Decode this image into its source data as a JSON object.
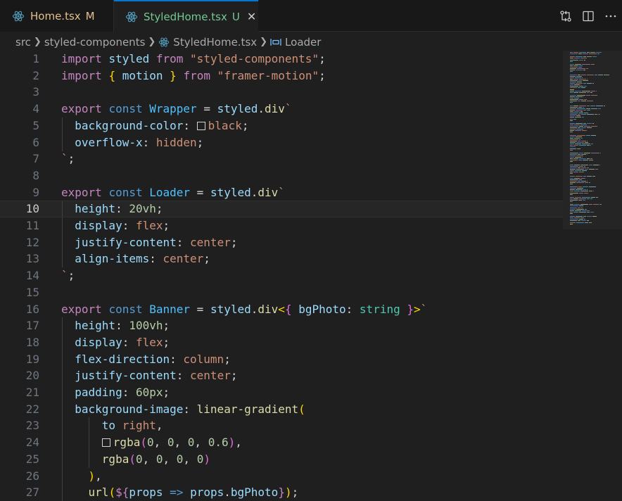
{
  "tabs": [
    {
      "label": "Home.tsx",
      "badge": "M",
      "icon": "react-icon"
    },
    {
      "label": "StyledHome.tsx",
      "badge": "U",
      "icon": "react-icon",
      "close": "✕"
    }
  ],
  "breadcrumb": {
    "parts": [
      "src",
      "styled-components",
      "StyledHome.tsx",
      "Loader"
    ]
  },
  "colors": {
    "accent": "#0078d4",
    "modified": "#e2c08d",
    "untracked": "#73c991"
  },
  "editor": {
    "active_line": 10,
    "lines": [
      {
        "n": "1",
        "tokens": [
          [
            "kp",
            "import"
          ],
          [
            "w",
            " "
          ],
          [
            "p",
            "styled"
          ],
          [
            "w",
            " "
          ],
          [
            "kp",
            "from"
          ],
          [
            "w",
            " "
          ],
          [
            "s",
            "\"styled-components\""
          ],
          [
            "w",
            ";"
          ]
        ]
      },
      {
        "n": "2",
        "tokens": [
          [
            "kp",
            "import"
          ],
          [
            "w",
            " "
          ],
          [
            "y",
            "{"
          ],
          [
            "w",
            " "
          ],
          [
            "p",
            "motion"
          ],
          [
            "w",
            " "
          ],
          [
            "y",
            "}"
          ],
          [
            "w",
            " "
          ],
          [
            "kp",
            "from"
          ],
          [
            "w",
            " "
          ],
          [
            "s",
            "\"framer-motion\""
          ],
          [
            "w",
            ";"
          ]
        ]
      },
      {
        "n": "3",
        "tokens": []
      },
      {
        "n": "4",
        "tokens": [
          [
            "kp",
            "export"
          ],
          [
            "w",
            " "
          ],
          [
            "k",
            "const"
          ],
          [
            "w",
            " "
          ],
          [
            "v",
            "Wrapper"
          ],
          [
            "w",
            " = "
          ],
          [
            "p",
            "styled"
          ],
          [
            "w",
            "."
          ],
          [
            "f",
            "div"
          ],
          [
            "s",
            "`"
          ]
        ]
      },
      {
        "n": "5",
        "guides": [
          1
        ],
        "tokens": [
          [
            "w",
            "  "
          ],
          [
            "p",
            "background-color"
          ],
          [
            "w",
            ": "
          ],
          [
            "sw",
            ""
          ],
          [
            "s",
            "black"
          ],
          [
            "w",
            ";"
          ]
        ]
      },
      {
        "n": "6",
        "guides": [
          1
        ],
        "tokens": [
          [
            "w",
            "  "
          ],
          [
            "p",
            "overflow-x"
          ],
          [
            "w",
            ": "
          ],
          [
            "s",
            "hidden"
          ],
          [
            "w",
            ";"
          ]
        ]
      },
      {
        "n": "7",
        "tokens": [
          [
            "s",
            "`"
          ],
          [
            "w",
            ";"
          ]
        ]
      },
      {
        "n": "8",
        "tokens": []
      },
      {
        "n": "9",
        "tokens": [
          [
            "kp",
            "export"
          ],
          [
            "w",
            " "
          ],
          [
            "k",
            "const"
          ],
          [
            "w",
            " "
          ],
          [
            "v",
            "Loader"
          ],
          [
            "w",
            " = "
          ],
          [
            "p",
            "styled"
          ],
          [
            "w",
            "."
          ],
          [
            "f",
            "div"
          ],
          [
            "s",
            "`"
          ]
        ]
      },
      {
        "n": "10",
        "guides": [
          1
        ],
        "tokens": [
          [
            "w",
            "  "
          ],
          [
            "p",
            "height"
          ],
          [
            "w",
            ": "
          ],
          [
            "n",
            "20vh"
          ],
          [
            "w",
            ";"
          ]
        ]
      },
      {
        "n": "11",
        "guides": [
          1
        ],
        "tokens": [
          [
            "w",
            "  "
          ],
          [
            "p",
            "display"
          ],
          [
            "w",
            ": "
          ],
          [
            "s",
            "flex"
          ],
          [
            "w",
            ";"
          ]
        ]
      },
      {
        "n": "12",
        "guides": [
          1
        ],
        "tokens": [
          [
            "w",
            "  "
          ],
          [
            "p",
            "justify-content"
          ],
          [
            "w",
            ": "
          ],
          [
            "s",
            "center"
          ],
          [
            "w",
            ";"
          ]
        ]
      },
      {
        "n": "13",
        "guides": [
          1
        ],
        "tokens": [
          [
            "w",
            "  "
          ],
          [
            "p",
            "align-items"
          ],
          [
            "w",
            ": "
          ],
          [
            "s",
            "center"
          ],
          [
            "w",
            ";"
          ]
        ]
      },
      {
        "n": "14",
        "tokens": [
          [
            "s",
            "`"
          ],
          [
            "w",
            ";"
          ]
        ]
      },
      {
        "n": "15",
        "tokens": []
      },
      {
        "n": "16",
        "tokens": [
          [
            "kp",
            "export"
          ],
          [
            "w",
            " "
          ],
          [
            "k",
            "const"
          ],
          [
            "w",
            " "
          ],
          [
            "v",
            "Banner"
          ],
          [
            "w",
            " = "
          ],
          [
            "p",
            "styled"
          ],
          [
            "w",
            "."
          ],
          [
            "f",
            "div"
          ],
          [
            "y",
            "<"
          ],
          [
            "m",
            "{"
          ],
          [
            "w",
            " "
          ],
          [
            "p",
            "bgPhoto"
          ],
          [
            "w",
            ": "
          ],
          [
            "t",
            "string"
          ],
          [
            "w",
            " "
          ],
          [
            "m",
            "}"
          ],
          [
            "y",
            ">"
          ],
          [
            "s",
            "`"
          ]
        ]
      },
      {
        "n": "17",
        "guides": [
          1
        ],
        "tokens": [
          [
            "w",
            "  "
          ],
          [
            "p",
            "height"
          ],
          [
            "w",
            ": "
          ],
          [
            "n",
            "100vh"
          ],
          [
            "w",
            ";"
          ]
        ]
      },
      {
        "n": "18",
        "guides": [
          1
        ],
        "tokens": [
          [
            "w",
            "  "
          ],
          [
            "p",
            "display"
          ],
          [
            "w",
            ": "
          ],
          [
            "s",
            "flex"
          ],
          [
            "w",
            ";"
          ]
        ]
      },
      {
        "n": "19",
        "guides": [
          1
        ],
        "tokens": [
          [
            "w",
            "  "
          ],
          [
            "p",
            "flex-direction"
          ],
          [
            "w",
            ": "
          ],
          [
            "s",
            "column"
          ],
          [
            "w",
            ";"
          ]
        ]
      },
      {
        "n": "20",
        "guides": [
          1
        ],
        "tokens": [
          [
            "w",
            "  "
          ],
          [
            "p",
            "justify-content"
          ],
          [
            "w",
            ": "
          ],
          [
            "s",
            "center"
          ],
          [
            "w",
            ";"
          ]
        ]
      },
      {
        "n": "21",
        "guides": [
          1
        ],
        "tokens": [
          [
            "w",
            "  "
          ],
          [
            "p",
            "padding"
          ],
          [
            "w",
            ": "
          ],
          [
            "n",
            "60px"
          ],
          [
            "w",
            ";"
          ]
        ]
      },
      {
        "n": "22",
        "guides": [
          1
        ],
        "tokens": [
          [
            "w",
            "  "
          ],
          [
            "p",
            "background-image"
          ],
          [
            "w",
            ": "
          ],
          [
            "f",
            "linear-gradient"
          ],
          [
            "y",
            "("
          ]
        ]
      },
      {
        "n": "23",
        "guides": [
          1,
          2
        ],
        "tokens": [
          [
            "w",
            "      "
          ],
          [
            "p",
            "to"
          ],
          [
            "w",
            " "
          ],
          [
            "s",
            "right"
          ],
          [
            "w",
            ","
          ]
        ]
      },
      {
        "n": "24",
        "guides": [
          1,
          2
        ],
        "tokens": [
          [
            "w",
            "      "
          ],
          [
            "sw",
            ""
          ],
          [
            "f",
            "rgba"
          ],
          [
            "m",
            "("
          ],
          [
            "n",
            "0"
          ],
          [
            "w",
            ", "
          ],
          [
            "n",
            "0"
          ],
          [
            "w",
            ", "
          ],
          [
            "n",
            "0"
          ],
          [
            "w",
            ", "
          ],
          [
            "n",
            "0.6"
          ],
          [
            "m",
            ")"
          ],
          [
            "w",
            ","
          ]
        ]
      },
      {
        "n": "25",
        "guides": [
          1,
          2
        ],
        "tokens": [
          [
            "w",
            "      "
          ],
          [
            "f",
            "rgba"
          ],
          [
            "m",
            "("
          ],
          [
            "n",
            "0"
          ],
          [
            "w",
            ", "
          ],
          [
            "n",
            "0"
          ],
          [
            "w",
            ", "
          ],
          [
            "n",
            "0"
          ],
          [
            "w",
            ", "
          ],
          [
            "n",
            "0"
          ],
          [
            "m",
            ")"
          ]
        ]
      },
      {
        "n": "26",
        "guides": [
          1
        ],
        "tokens": [
          [
            "w",
            "    "
          ],
          [
            "y",
            ")"
          ],
          [
            "w",
            ","
          ]
        ]
      },
      {
        "n": "27",
        "guides": [
          1
        ],
        "tokens": [
          [
            "w",
            "    "
          ],
          [
            "f",
            "url"
          ],
          [
            "y",
            "("
          ],
          [
            "kp",
            "${"
          ],
          [
            "p",
            "props"
          ],
          [
            "w",
            " "
          ],
          [
            "k",
            "=>"
          ],
          [
            "w",
            " "
          ],
          [
            "p",
            "props"
          ],
          [
            "w",
            "."
          ],
          [
            "p",
            "bgPhoto"
          ],
          [
            "kp",
            "}"
          ],
          [
            "y",
            ")"
          ],
          [
            "w",
            ";"
          ]
        ]
      }
    ]
  }
}
